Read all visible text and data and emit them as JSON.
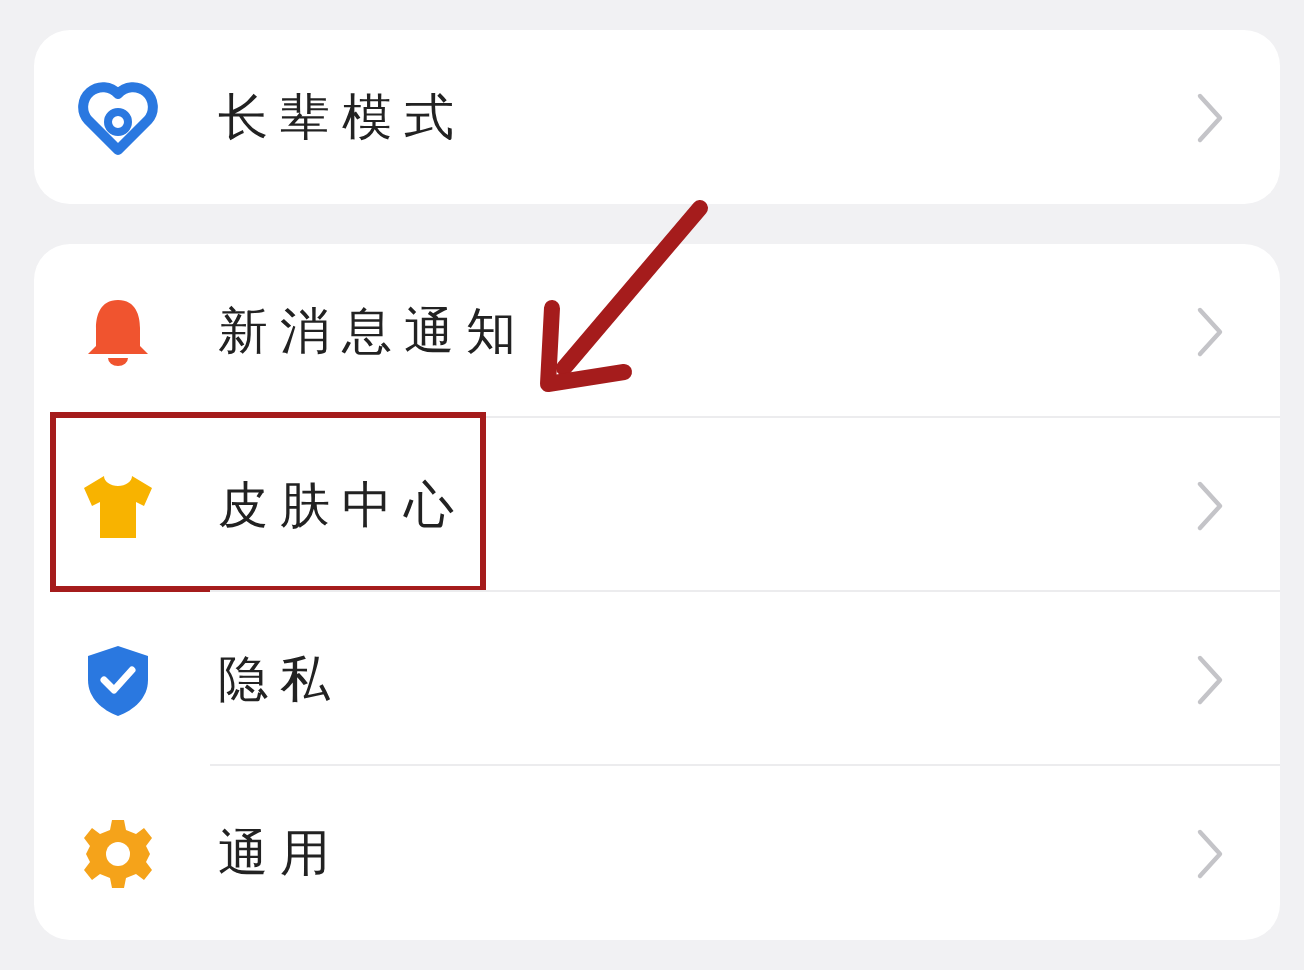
{
  "groups": [
    {
      "items": [
        {
          "label": "长辈模式",
          "kind": "heart",
          "highlighted": false
        }
      ]
    },
    {
      "items": [
        {
          "label": "新消息通知",
          "kind": "bell",
          "highlighted": false
        },
        {
          "label": "皮肤中心",
          "kind": "shirt",
          "highlighted": true
        },
        {
          "label": "隐私",
          "kind": "shield",
          "highlighted": false
        },
        {
          "label": "通用",
          "kind": "gear",
          "highlighted": false
        }
      ]
    }
  ],
  "annotation": {
    "arrow": true
  }
}
